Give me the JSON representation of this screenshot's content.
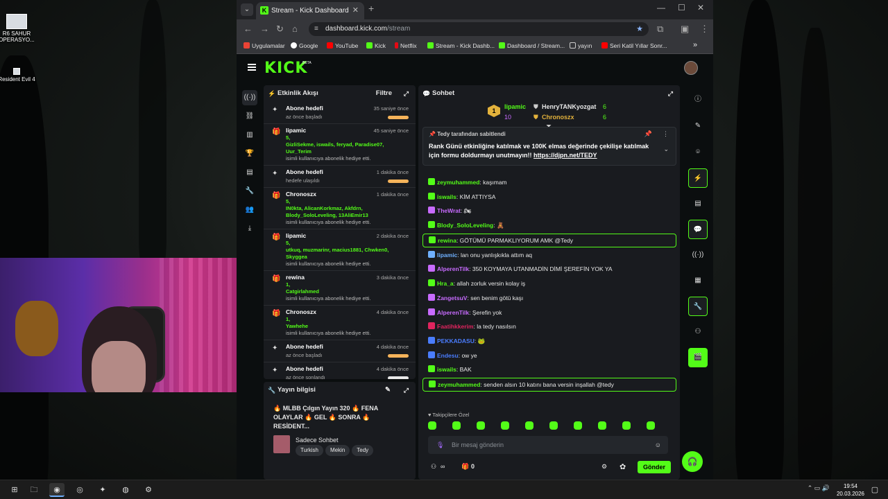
{
  "desktop": {
    "icons": [
      {
        "label": "R6 SAHUR OPERASYO..."
      },
      {
        "label": "Resident Evil 4"
      }
    ]
  },
  "browser": {
    "tab_title": "Stream - Kick Dashboard",
    "url_domain": "dashboard.kick.com",
    "url_path": "/stream",
    "bookmarks": [
      "Uygulamalar",
      "Google",
      "YouTube",
      "Kick",
      "Netflix",
      "Stream - Kick Dashb...",
      "Dashboard / Stream...",
      "yayın",
      "Seri Katil Yıllar Sonr..."
    ],
    "bookmark_more": "»"
  },
  "kick": {
    "logo": "KICK",
    "beta": "BETA",
    "activity": {
      "title": "Etkinlik Akışı",
      "filter": "Filtre",
      "events": [
        {
          "name": "Abone hedefi",
          "time": "35 saniye önce",
          "sub": "az önce başladı",
          "type": "goal"
        },
        {
          "name": "lipamic",
          "time": "45 saniye önce",
          "count": "5,",
          "names": "GizliSekme, iswails, feryad, Paradise07, Uur_Terim",
          "text": "isimli kullanıcıya abonelik hediye etti.",
          "type": "gift"
        },
        {
          "name": "Abone hedefi",
          "time": "1 dakika önce",
          "sub": "hedefe ulaşıldı",
          "type": "goal"
        },
        {
          "name": "Chronoszx",
          "time": "1 dakika önce",
          "count": "5,",
          "names": "IN0kta, AlicanKorkmaz, Akfdrn, Blody_SoloLeveling, 13AliEmir13",
          "text": "isimli kullanıcıya abonelik hediye etti.",
          "type": "gift"
        },
        {
          "name": "lipamic",
          "time": "2 dakika önce",
          "count": "5,",
          "names": "utkuq, muzmarinr, macius1881, Chwken0, Skyggea",
          "text": "isimli kullanıcıya abonelik hediye etti.",
          "type": "gift"
        },
        {
          "name": "rewina",
          "time": "3 dakika önce",
          "count": "1,",
          "names": "Catgirlahmed",
          "text": "isimli kullanıcıya abonelik hediye etti.",
          "type": "gift"
        },
        {
          "name": "Chronoszx",
          "time": "4 dakika önce",
          "count": "1,",
          "names": "Yawhehe",
          "text": "isimli kullanıcıya abonelik hediye etti.",
          "type": "gift"
        },
        {
          "name": "Abone hedefi",
          "time": "4 dakika önce",
          "sub": "az önce başladı",
          "type": "goal"
        },
        {
          "name": "Abone hedefi",
          "time": "4 dakika önce",
          "sub": "az önce sonlandı",
          "type": "goal"
        }
      ]
    },
    "info": {
      "title": "Yayın bilgisi",
      "stream_title": "🔥 MLBB Çılgın Yayın 320 🔥 FENA OLAYLAR 🔥 GEL 🔥 SONRA 🔥 RESİDENT...",
      "category": "Sadece Sohbet",
      "tags": [
        "Turkish",
        "Mekin",
        "Tedy"
      ]
    },
    "chat": {
      "title": "Sohbet",
      "leaders": [
        {
          "rank": "1",
          "name": "lipamic",
          "value": "10"
        },
        {
          "name": "HenryTANKyozgat",
          "value": "6"
        },
        {
          "name": "Chronoszx",
          "value": "6"
        }
      ],
      "pinned_header": "Tedy tarafından sabitlendi",
      "pinned_text": "Rank Günü etkinliğine katılmak ve 100K elmas değerinde çekilişe katılmak için formu doldurmayı unutmayın!!",
      "pinned_link": "https://djpn.net/TEDY",
      "messages": [
        {
          "user": "zeymuhammed",
          "text": "kaşımam",
          "color": "#53fc18"
        },
        {
          "user": "iswails",
          "text": "KİM ATTIYSA",
          "color": "#53fc18"
        },
        {
          "user": "TheWrat",
          "text": "🏍",
          "color": "#c86bff"
        },
        {
          "user": "Blody_SoloLeveling",
          "text": "🧸",
          "color": "#53fc18"
        },
        {
          "user": "rewina",
          "text": "GÖTÜMÜ PARMAKLIYORUM AMK @Tedy",
          "color": "#53fc18",
          "hl": true
        },
        {
          "user": "lipamic",
          "text": "lan onu yanlışkıkla attım aq",
          "color": "#6fb0ff"
        },
        {
          "user": "AlperenTilk",
          "text": "350 KOYMAYA UTANMADİN DİMİ ŞEREFİN YOK YA",
          "color": "#c86bff"
        },
        {
          "user": "Hra_a",
          "text": "allah zorluk versin kolay iş",
          "color": "#53fc18"
        },
        {
          "user": "ZangetsuV",
          "text": "sen benim götü kaşı",
          "color": "#c86bff"
        },
        {
          "user": "AlperenTilk",
          "text": "Şerefin yok",
          "color": "#c86bff"
        },
        {
          "user": "Faatihkkerim",
          "text": "la tedy nasılsın",
          "color": "#e0245e"
        },
        {
          "user": "PEKKADASU",
          "text": "🐸",
          "color": "#4a7dff"
        },
        {
          "user": "Endesu",
          "text": "ow ye",
          "color": "#4a7dff"
        },
        {
          "user": "iswails",
          "text": "BAK",
          "color": "#53fc18"
        },
        {
          "user": "zeymuhammed",
          "text": "senden alsın 10 katını bana versin inşallah @tedy",
          "color": "#53fc18",
          "hl": true
        }
      ],
      "followers_only": "Takipçilere Özel",
      "input_placeholder": "Bir mesaj gönderin",
      "count_left": "∞",
      "count_right": "0",
      "send": "Gönder"
    }
  },
  "taskbar": {
    "time": "19:54",
    "date": "20.03.2026"
  }
}
